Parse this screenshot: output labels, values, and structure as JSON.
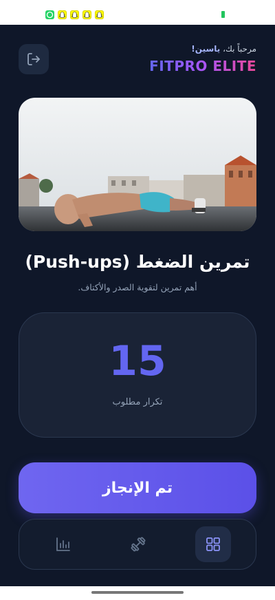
{
  "statusbar": {
    "notifications": [
      "whatsapp-icon",
      "snapchat-icon",
      "snapchat-icon",
      "snapchat-icon",
      "snapchat-icon"
    ]
  },
  "header": {
    "greeting_prefix": "مرحباً بك،",
    "user_name": "ياسين!",
    "brand": "FITPRO ELITE",
    "logout_icon": "logout-icon"
  },
  "exercise": {
    "title": "تمرين الضغط (Push-ups)",
    "subtitle": "أهم تمرين لتقوية الصدر والأكتاف.",
    "reps": "15",
    "reps_label": "تكرار مطلوب"
  },
  "actions": {
    "done_label": "تم الإنجاز"
  },
  "nav": {
    "items": [
      {
        "icon": "grid-icon",
        "active": true
      },
      {
        "icon": "dumbbell-icon",
        "active": false
      },
      {
        "icon": "chart-icon",
        "active": false
      }
    ]
  },
  "colors": {
    "background": "#0f1729",
    "accent": "#6366f1",
    "card": "#1a2336"
  }
}
